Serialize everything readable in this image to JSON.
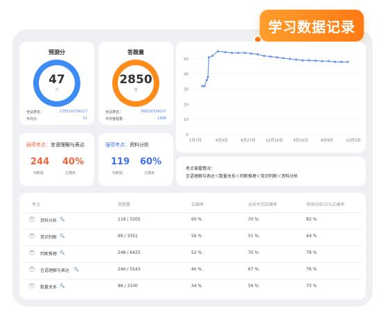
{
  "banner": {
    "label": "学习数据记录"
  },
  "score_card": {
    "title": "预测分",
    "value": "47",
    "unit": "分",
    "rank_label": "全站排名：",
    "rank_value": "175519/334127",
    "avg_label": "平均分：",
    "avg_value": "51",
    "ring_color": "#3d8bf5"
  },
  "volume_card": {
    "title": "答题量",
    "value": "2850",
    "unit": "道",
    "rank_label": "全站排名：",
    "rank_value": "56833/334127",
    "avg_label": "平均答题量：",
    "avg_value": "1608",
    "ring_color": "#ff8c1a"
  },
  "weak_card": {
    "tag": "弱项考点：",
    "topic": "言语理解与表达",
    "count": "244",
    "count_label": "判断题",
    "rate": "40%",
    "rate_label": "正确率",
    "accent": "#f0643c"
  },
  "strong_card": {
    "tag": "强项考点：",
    "topic": "资料分析",
    "count": "119",
    "count_label": "判断题",
    "rate": "60%",
    "rate_label": "正确率",
    "accent": "#3d6ff0"
  },
  "chart_data": {
    "type": "line",
    "x": [
      "1月7日",
      "5月3日",
      "8月27日",
      "12月20日",
      "4月15日",
      "8月9日",
      "12月3日"
    ],
    "y_ticks": [
      0,
      10,
      20,
      30,
      40,
      50
    ],
    "ylim": [
      0,
      55
    ],
    "series": [
      {
        "values": [
          32,
          32,
          36,
          38,
          51,
          52,
          55,
          54.5,
          54,
          54,
          54,
          53.5,
          53,
          52,
          51.5,
          51,
          50.5,
          50,
          49.5,
          49,
          49,
          48.8,
          48.5,
          48.5,
          48,
          48,
          48
        ]
      }
    ],
    "line_color": "#6a95e8"
  },
  "mastery": {
    "title": "考点掌握情况：",
    "order": "言语理解与表达＜数量关系＜判断推理＜常识判断＜资料分析"
  },
  "table": {
    "headers": [
      "考点",
      "答题量",
      "正确率",
      "全站平均正确率",
      "预测分前10%正确率"
    ],
    "rows": [
      {
        "topic": "资料分析",
        "count": "119 / 3205",
        "rate": "60 %",
        "avg": "70 %",
        "top10": "82 %"
      },
      {
        "topic": "常识判断",
        "count": "69 / 3351",
        "rate": "56 %",
        "avg": "51 %",
        "top10": "64 %"
      },
      {
        "topic": "判断推理",
        "count": "248 / 6425",
        "rate": "52 %",
        "avg": "70 %",
        "top10": "79 %"
      },
      {
        "topic": "言语理解与表达",
        "count": "244 / 5543",
        "rate": "40 %",
        "avg": "67 %",
        "top10": "76 %"
      },
      {
        "topic": "数量关系",
        "count": "88 / 3100",
        "rate": "34 %",
        "avg": "59 %",
        "top10": "73 %"
      }
    ]
  }
}
